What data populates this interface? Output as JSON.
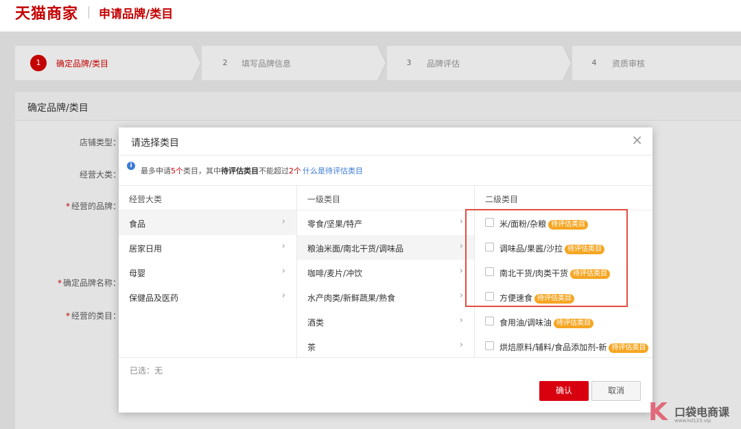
{
  "header": {
    "logo": "天猫商家",
    "page_title": "申请品牌/类目"
  },
  "steps": [
    {
      "num": "1",
      "label": "确定品牌/类目",
      "active": true
    },
    {
      "num": "2",
      "label": "填写品牌信息",
      "active": false
    },
    {
      "num": "3",
      "label": "品牌评估",
      "active": false
    },
    {
      "num": "4",
      "label": "资质审核",
      "active": false
    }
  ],
  "panel": {
    "title": "确定品牌/类目",
    "labels": {
      "shop_type": "店铺类型：",
      "main_category": "经营大类：",
      "brand": "经营的品牌：",
      "brand_name": "确定品牌名称：",
      "category": "经营的类目："
    }
  },
  "modal": {
    "title": "请选择类目",
    "close": "×",
    "notice": {
      "part1": "最多申请",
      "count1": "5个",
      "part2": "类目，其中",
      "bold": "待评估类目",
      "part3": "不能超过",
      "count2": "2个",
      "link": "什么是待评估类目"
    },
    "col1": {
      "header": "经营大类",
      "items": [
        "食品",
        "居家日用",
        "母婴",
        "保健品及医药"
      ]
    },
    "col2": {
      "header": "一级类目",
      "items": [
        "零食/坚果/特产",
        "粮油米面/南北干货/调味品",
        "咖啡/麦片/冲饮",
        "水产肉类/新鲜蔬果/熟食",
        "酒类",
        "茶"
      ]
    },
    "col3": {
      "header": "二级类目",
      "items": [
        {
          "label": "米/面粉/杂粮",
          "badge": "待评估类目"
        },
        {
          "label": "调味品/果酱/沙拉",
          "badge": "待评估类目"
        },
        {
          "label": "南北干货/肉类干货",
          "badge": "待评估类目"
        },
        {
          "label": "方便速食",
          "badge": "待评估类目"
        },
        {
          "label": "食用油/调味油",
          "badge": "待评估类目"
        },
        {
          "label": "烘焙原料/辅料/食品添加剂-新",
          "badge": "待评估类目"
        }
      ]
    },
    "selected": "已选：无",
    "confirm": "确认",
    "cancel": "取消"
  },
  "watermark": {
    "k": "K",
    "text": "口袋电商课",
    "url": "www.kd123.vip"
  },
  "colors": {
    "brand_red": "#c40000",
    "badge": "#f5a623",
    "highlight": "#e34b3f"
  }
}
